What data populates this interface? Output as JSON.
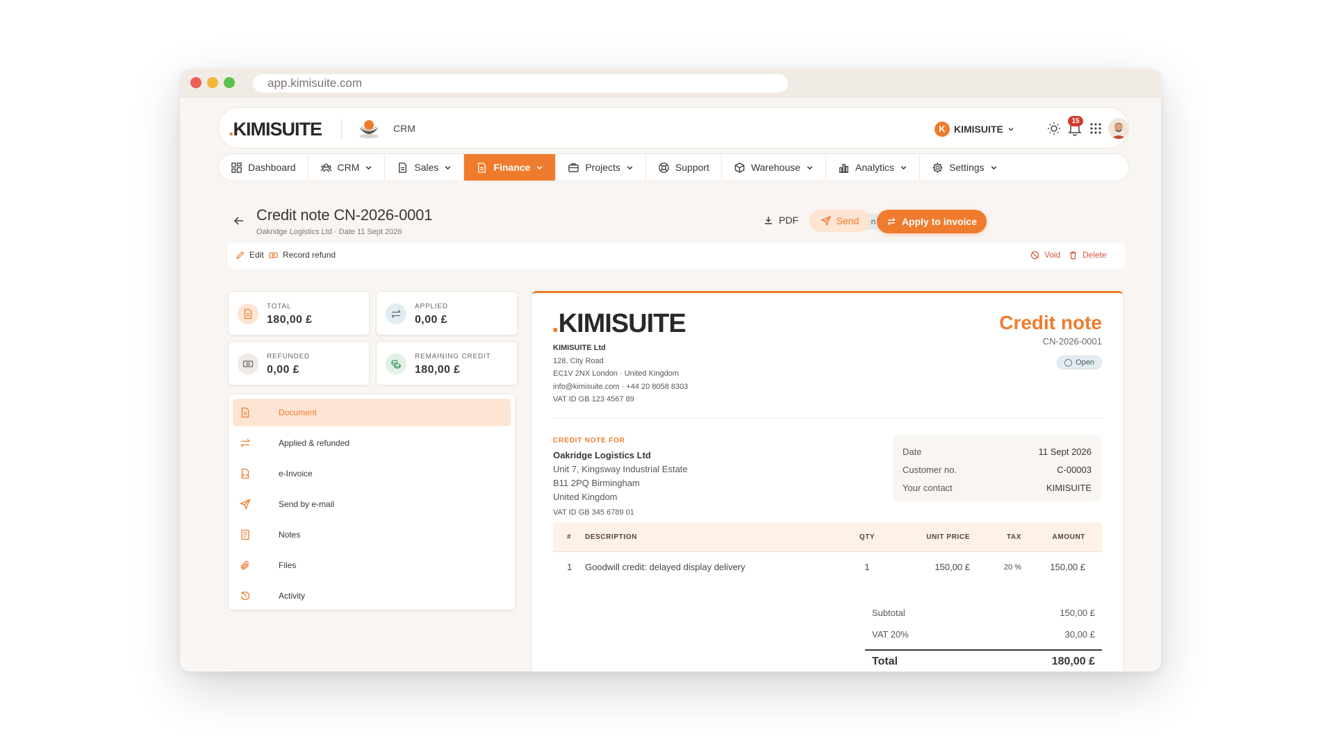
{
  "browser": {
    "url": "app.kimisuite.com"
  },
  "topbar": {
    "logo": "KIMISUITE",
    "module": "CRM",
    "user_initial": "K",
    "user_name": "KIMISUITE",
    "notification_count": "15"
  },
  "nav": [
    {
      "label": "Dashboard",
      "icon": "dashboard-icon",
      "chevron": false
    },
    {
      "label": "CRM",
      "icon": "users-icon",
      "chevron": true
    },
    {
      "label": "Sales",
      "icon": "document-icon",
      "chevron": true
    },
    {
      "label": "Finance",
      "icon": "document-icon",
      "chevron": true,
      "active": true
    },
    {
      "label": "Projects",
      "icon": "briefcase-icon",
      "chevron": true
    },
    {
      "label": "Support",
      "icon": "lifebuoy-icon",
      "chevron": false
    },
    {
      "label": "Warehouse",
      "icon": "box-icon",
      "chevron": true
    },
    {
      "label": "Analytics",
      "icon": "bar-chart-icon",
      "chevron": true
    },
    {
      "label": "Settings",
      "icon": "gear-icon",
      "chevron": true
    }
  ],
  "header": {
    "title": "Credit note CN-2026-0001",
    "subtitle": "Oakridge Logistics Ltd · Date 11 Sept 2026",
    "status": "Open",
    "pdf": "PDF",
    "send": "Send",
    "apply": "Apply to invoice"
  },
  "actions": {
    "edit": "Edit",
    "record_refund": "Record refund",
    "void": "Void",
    "delete": "Delete"
  },
  "stats": [
    {
      "label": "TOTAL",
      "value": "180,00 £",
      "icon": "invoice-icon",
      "color": "#ef7b2d",
      "bg": "#fde4d3"
    },
    {
      "label": "APPLIED",
      "value": "0,00 £",
      "icon": "swap-arrows-icon",
      "color": "#5a6b74",
      "bg": "#e3ecf0"
    },
    {
      "label": "REFUNDED",
      "value": "0,00 £",
      "icon": "banknote-icon",
      "color": "#6e6864",
      "bg": "#eeeae6"
    },
    {
      "label": "REMAINING CREDIT",
      "value": "180,00 £",
      "icon": "coins-icon",
      "color": "#3f9a5a",
      "bg": "#e1f1e6"
    }
  ],
  "menu": [
    {
      "label": "Document",
      "icon": "document-icon",
      "active": true
    },
    {
      "label": "Applied & refunded",
      "icon": "swap-arrows-icon"
    },
    {
      "label": "e-Invoice",
      "icon": "file-code-icon"
    },
    {
      "label": "Send by e-mail",
      "icon": "send-icon"
    },
    {
      "label": "Notes",
      "icon": "notes-icon"
    },
    {
      "label": "Files",
      "icon": "paperclip-icon"
    },
    {
      "label": "Activity",
      "icon": "history-icon"
    }
  ],
  "document": {
    "logo": "KIMISUITE",
    "company_name": "KIMISUITE Ltd",
    "company_lines": [
      "128, City Road",
      "EC1V 2NX London · United Kingdom",
      "info@kimisuite.com · +44 20 8058 8303",
      "VAT ID GB 123 4567 89"
    ],
    "title": "Credit note",
    "number": "CN-2026-0001",
    "status": "Open",
    "bill_label": "CREDIT NOTE FOR",
    "customer_name": "Oakridge Logistics Ltd",
    "customer_lines": [
      "Unit 7, Kingsway Industrial Estate",
      "B11 2PQ Birmingham",
      "United Kingdom"
    ],
    "customer_vat": "VAT ID GB 345 6789 01",
    "meta": [
      {
        "label": "Date",
        "value": "11 Sept 2026"
      },
      {
        "label": "Customer no.",
        "value": "C-00003"
      },
      {
        "label": "Your contact",
        "value": "KIMISUITE"
      }
    ],
    "columns": {
      "num": "#",
      "desc": "DESCRIPTION",
      "qty": "QTY",
      "unit": "UNIT PRICE",
      "tax": "TAX",
      "amount": "AMOUNT"
    },
    "rows": [
      {
        "num": "1",
        "desc": "Goodwill credit: delayed display delivery",
        "qty": "1",
        "unit": "150,00 £",
        "tax": "20 %",
        "amount": "150,00 £"
      }
    ],
    "subtotal_label": "Subtotal",
    "subtotal": "150,00 £",
    "vat_label": "VAT 20%",
    "vat": "30,00 £",
    "total_label": "Total",
    "total": "180,00 £"
  },
  "colors": {
    "accent": "#ef7b2d",
    "danger": "#d3563a",
    "status_bg": "#e3ecf0"
  }
}
